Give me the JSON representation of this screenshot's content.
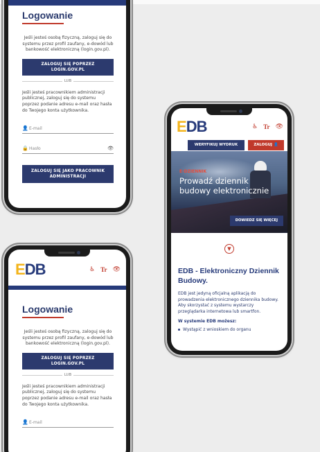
{
  "colors": {
    "navy": "#2c3a6e",
    "red": "#c0392b",
    "logo_yellow": "#f3b41b",
    "logo_blue": "#263a7a"
  },
  "logo": {
    "e": "E",
    "db": "DB"
  },
  "header_icons": [
    "accessibility-icon",
    "text-size-icon",
    "eye-contrast-icon"
  ],
  "header_icon_glyphs": {
    "text_size": "Tr"
  },
  "login": {
    "title": "Logowanie",
    "intro": "Jeśli jesteś osobą fizyczną, zaloguj się do systemu przez profil zaufany, e-dowód lub bankowość elektroniczną (login.gov.pl).",
    "login_gov_button": "ZALOGUJ SIĘ POPRZEZ LOGIN.GOV.PL",
    "or": "LUB",
    "admin_intro": "Jeśli jesteś pracownikiem administracji publicznej, zaloguj się do systemu poprzez podanie adresu e-mail oraz hasła do Twojego konta użytkownika.",
    "email_label": "E-mail",
    "password_label": "Hasło",
    "admin_button": "ZALOGUJ SIĘ JAKO PRACOWNIK ADMINISTRACJI"
  },
  "home": {
    "verify_button": "WERYFIKUJ WYDRUK",
    "login_button": "ZALOGUJ",
    "hero_tag": "E-DZIENNIK",
    "hero_heading": "Prowadź dziennik budowy elektronicznie",
    "hero_more": "DOWIEDZ SIĘ WIĘCEJ",
    "section_title": "EDB - Elektroniczny Dziennik Budowy.",
    "section_text": "EDB jest jedyną oficjalną aplikacją do prowadzenia elektronicznego dziennika budowy. Aby skorzystać z systemu wystarczy przeglądarka internetowa lub smartfon.",
    "list_title": "W systemie EDB możesz:",
    "list_items": [
      "Wystąpić z wnioskiem do organu"
    ]
  }
}
